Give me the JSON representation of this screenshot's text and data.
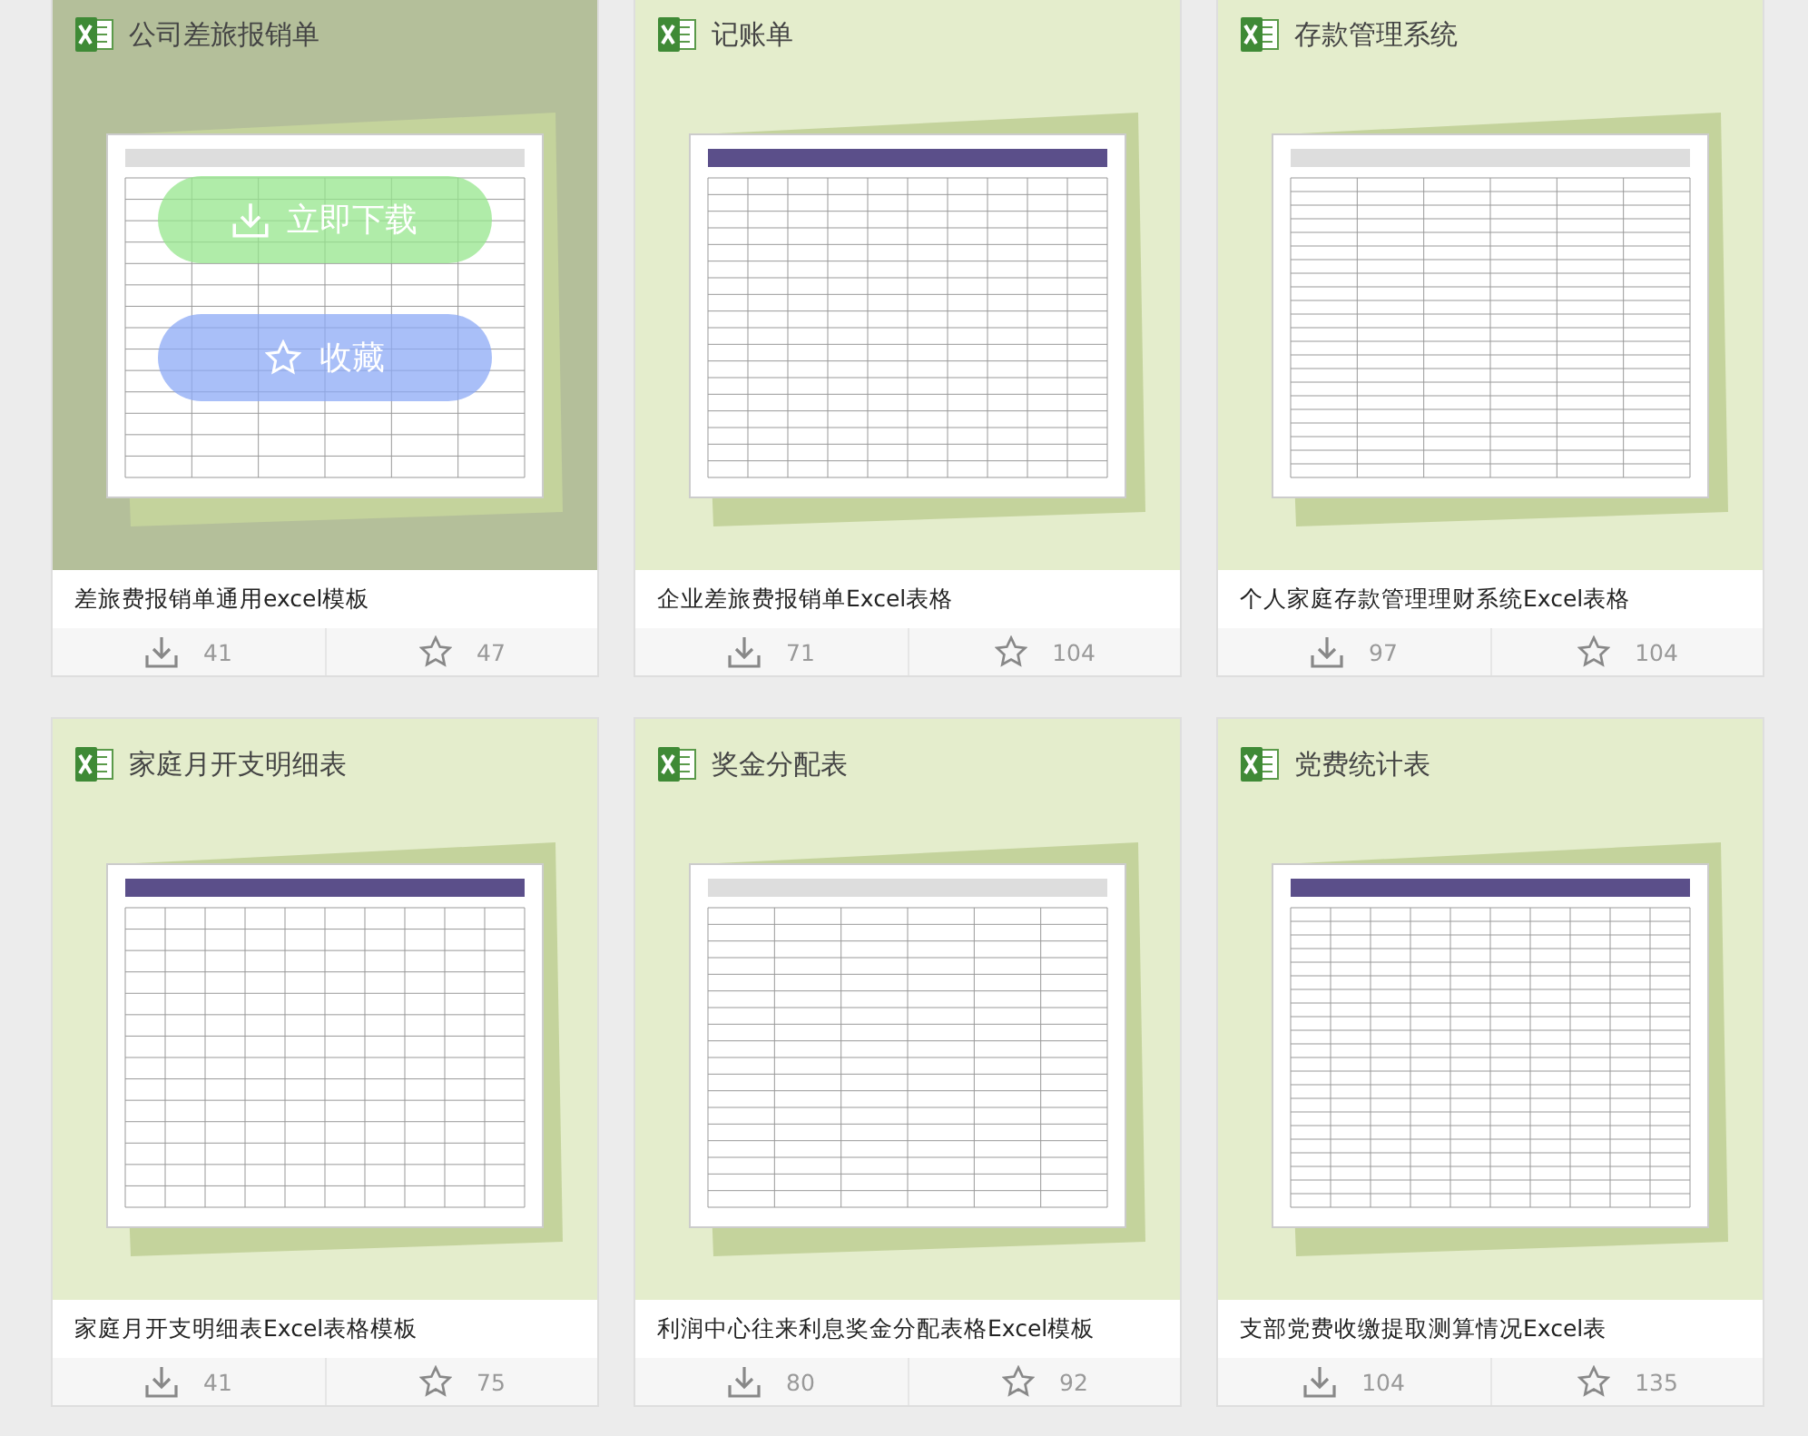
{
  "cards": [
    {
      "heading": "公司差旅报销单",
      "title": "差旅费报销单通用excel模板",
      "downloads": "41",
      "favorites": "47",
      "overlay": {
        "download_label": "立即下载",
        "favorite_label": "收藏"
      }
    },
    {
      "heading": "记账单",
      "title": "企业差旅费报销单Excel表格",
      "downloads": "71",
      "favorites": "104"
    },
    {
      "heading": "存款管理系统",
      "title": "个人家庭存款管理理财系统Excel表格",
      "downloads": "97",
      "favorites": "104"
    },
    {
      "heading": "家庭月开支明细表",
      "title": "家庭月开支明细表Excel表格模板",
      "downloads": "41",
      "favorites": "75"
    },
    {
      "heading": "奖金分配表",
      "title": "利润中心往来利息奖金分配表格Excel模板",
      "downloads": "80",
      "favorites": "92"
    },
    {
      "heading": "党费统计表",
      "title": "支部党费收缴提取测算情况Excel表",
      "downloads": "104",
      "favorites": "135"
    }
  ]
}
